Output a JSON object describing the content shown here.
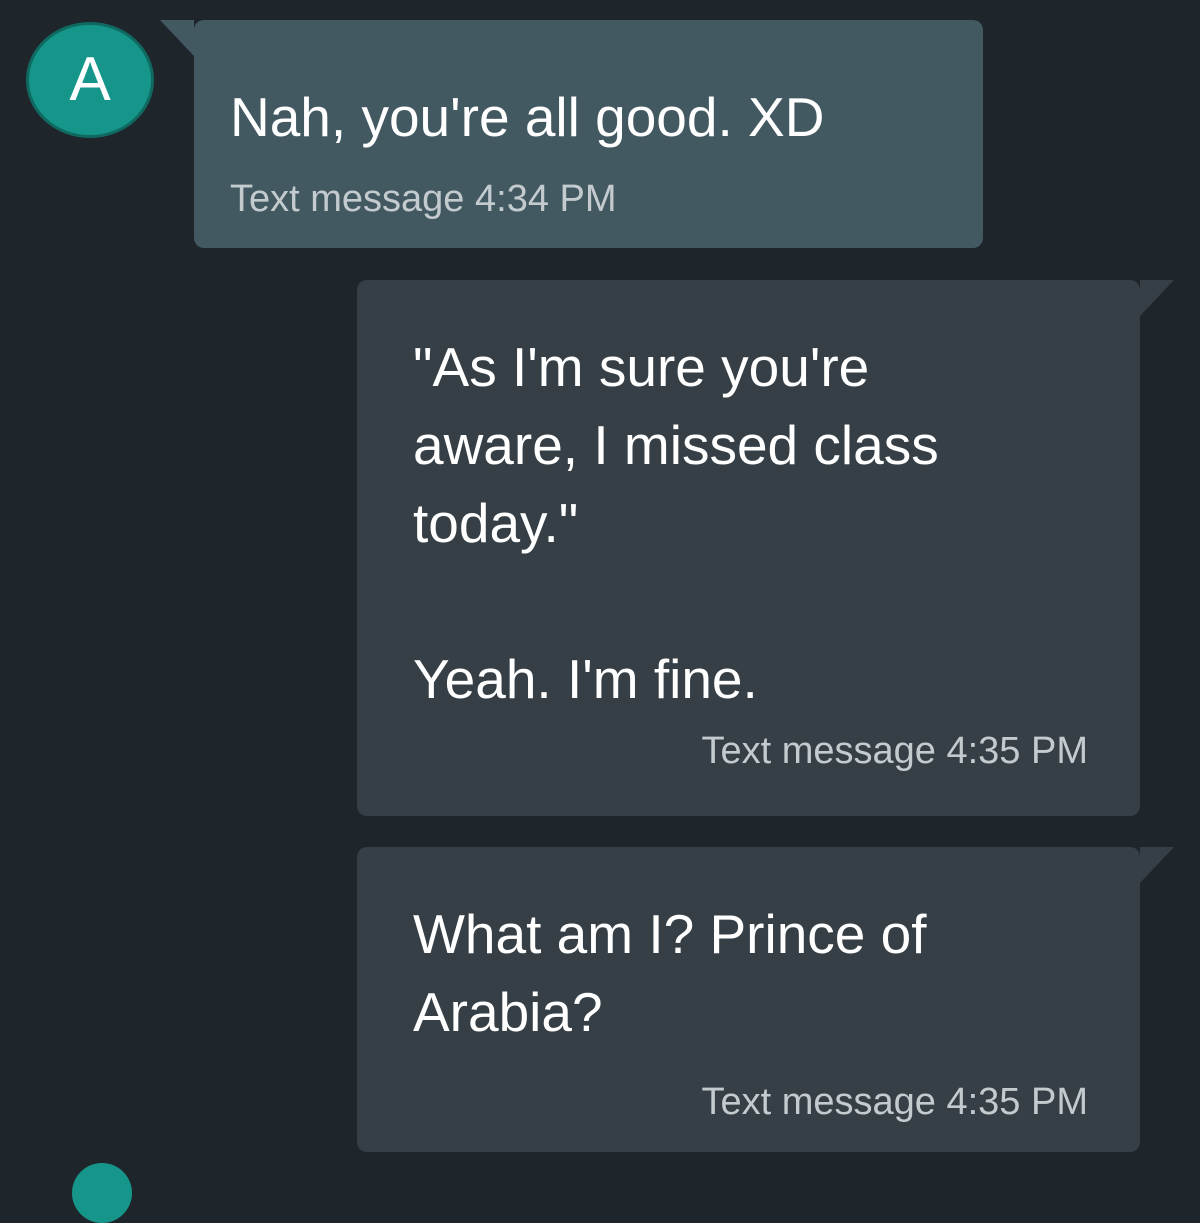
{
  "contact": {
    "avatar_initial": "A",
    "avatar_color": "#16968a"
  },
  "colors": {
    "background": "#1e262c",
    "incoming_bubble": "#435962",
    "outgoing_bubble": "#353f45"
  },
  "messages": [
    {
      "direction": "incoming",
      "text": "Nah, you're all good. XD",
      "meta": "Text message 4:34 PM"
    },
    {
      "direction": "outgoing",
      "text": "\"As I'm sure you're\naware, I missed class\ntoday.\"\n\nYeah. I'm fine.",
      "meta": "Text message 4:35 PM"
    },
    {
      "direction": "outgoing",
      "text": "What am I? Prince of\nArabia?",
      "meta": "Text message 4:35 PM"
    }
  ]
}
